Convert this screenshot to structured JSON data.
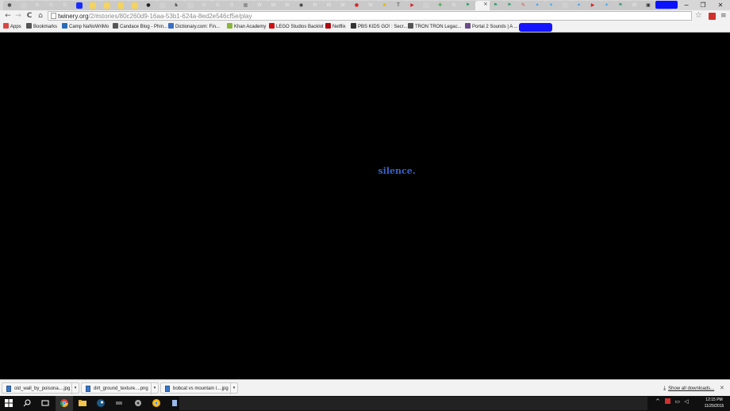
{
  "tabs": [
    {
      "icon": "globe-icon",
      "color": "#555555",
      "glyph": "●"
    },
    {
      "icon": "page-icon",
      "color": "#cfcfcf",
      "glyph": ""
    },
    {
      "icon": "google-icon",
      "color": "#e8e8e8",
      "glyph": "G"
    },
    {
      "icon": "google-icon",
      "color": "#e8e8e8",
      "glyph": "G"
    },
    {
      "icon": "google-icon",
      "color": "#e8e8e8",
      "glyph": "G"
    },
    {
      "icon": "blue-square-icon",
      "color": "#1a2bff",
      "glyph": ""
    },
    {
      "icon": "sticky-note-icon",
      "color": "#f4d35e",
      "glyph": ""
    },
    {
      "icon": "sticky-note-icon",
      "color": "#f4d35e",
      "glyph": ""
    },
    {
      "icon": "sticky-note-icon",
      "color": "#f4d35e",
      "glyph": ""
    },
    {
      "icon": "sticky-note-icon",
      "color": "#f4d35e",
      "glyph": ""
    },
    {
      "icon": "mickey-icon",
      "color": "#222222",
      "glyph": "●"
    },
    {
      "icon": "page-icon",
      "color": "#cfcfcf",
      "glyph": ""
    },
    {
      "icon": "horse-icon",
      "color": "#555555",
      "glyph": "♞"
    },
    {
      "icon": "page-icon",
      "color": "#cfcfcf",
      "glyph": ""
    },
    {
      "icon": "google-icon",
      "color": "#e8e8e8",
      "glyph": "G"
    },
    {
      "icon": "google-icon",
      "color": "#e8e8e8",
      "glyph": "G"
    },
    {
      "icon": "google-icon",
      "color": "#e8e8e8",
      "glyph": "G"
    },
    {
      "icon": "calculator-icon",
      "color": "#777777",
      "glyph": "▦"
    },
    {
      "icon": "wikipedia-icon",
      "color": "#e8e8e8",
      "glyph": "W"
    },
    {
      "icon": "wikipedia-icon",
      "color": "#e8e8e8",
      "glyph": "W"
    },
    {
      "icon": "wikipedia-icon",
      "color": "#e8e8e8",
      "glyph": "W"
    },
    {
      "icon": "camera-icon",
      "color": "#333333",
      "glyph": "◉"
    },
    {
      "icon": "gmail-icon",
      "color": "#e8e8e8",
      "glyph": "M"
    },
    {
      "icon": "wikipedia-icon",
      "color": "#e8e8e8",
      "glyph": "W"
    },
    {
      "icon": "wikipedia-icon",
      "color": "#e8e8e8",
      "glyph": "W"
    },
    {
      "icon": "red-circle-icon",
      "color": "#d22b2b",
      "glyph": "●"
    },
    {
      "icon": "wikipedia-icon",
      "color": "#e8e8e8",
      "glyph": "W"
    },
    {
      "icon": "star-badge-icon",
      "color": "#e0b000",
      "glyph": "★"
    },
    {
      "icon": "nyt-icon",
      "color": "#333333",
      "glyph": "T"
    },
    {
      "icon": "youtube-icon",
      "color": "#e02020",
      "glyph": "▶"
    },
    {
      "icon": "page-icon",
      "color": "#cfcfcf",
      "glyph": ""
    },
    {
      "icon": "puzzle-icon",
      "color": "#46a848",
      "glyph": "✚"
    },
    {
      "icon": "google-icon",
      "color": "#e8e8e8",
      "glyph": "G"
    },
    {
      "icon": "flag-icon",
      "color": "#2e9e6b",
      "glyph": "⚑"
    },
    {
      "icon": "page-icon",
      "color": "#f2f2f2",
      "glyph": "",
      "active": true
    },
    {
      "icon": "flag-icon",
      "color": "#2e9e6b",
      "glyph": "⚑"
    },
    {
      "icon": "flag-icon",
      "color": "#2e9e6b",
      "glyph": "⚑"
    },
    {
      "icon": "pencil-icon",
      "color": "#d04040",
      "glyph": "✎"
    },
    {
      "icon": "twitter-icon",
      "color": "#3aa0e8",
      "glyph": "✦"
    },
    {
      "icon": "twitter-icon",
      "color": "#3aa0e8",
      "glyph": "✦"
    },
    {
      "icon": "page-icon",
      "color": "#cfcfcf",
      "glyph": ""
    },
    {
      "icon": "twitter-icon",
      "color": "#3aa0e8",
      "glyph": "✦"
    },
    {
      "icon": "youtube-icon",
      "color": "#e02020",
      "glyph": "▶"
    },
    {
      "icon": "twitter-icon",
      "color": "#3aa0e8",
      "glyph": "✦"
    },
    {
      "icon": "flag-icon",
      "color": "#2e9e6b",
      "glyph": "⚑"
    },
    {
      "icon": "wikipedia-icon",
      "color": "#e8e8e8",
      "glyph": "W"
    },
    {
      "icon": "square-outline-icon",
      "color": "#333333",
      "glyph": "▣"
    },
    {
      "icon": "page-icon",
      "color": "#cfcfcf",
      "glyph": ""
    }
  ],
  "window_controls": {
    "minimize": "−",
    "restore": "❐",
    "close": "✕"
  },
  "toolbar": {
    "back": "←",
    "forward": "→",
    "reload": "C",
    "home": "⌂",
    "url_host": "twinery.org",
    "url_path": "/2/#stories/80c260d9-16aa-53b1-624a-8ed2e546cf5e/play",
    "star": "☆",
    "menu": "≡"
  },
  "bookmarks": [
    {
      "label": "Apps",
      "icon": "apps-grid-icon",
      "color": "#d44"
    },
    {
      "label": "Bookmarks",
      "icon": "star-icon",
      "color": "#555"
    },
    {
      "label": "Camp NaNoWriMo",
      "icon": "tent-icon",
      "color": "#2a6ab8"
    },
    {
      "label": "Candace Blog - Phin...",
      "icon": "link-icon",
      "color": "#555"
    },
    {
      "label": "Dictionary.com: Fin...",
      "icon": "dictionary-icon",
      "color": "#3b6fc4"
    },
    {
      "label": "Khan Academy",
      "icon": "leaf-icon",
      "color": "#8ab63c"
    },
    {
      "label": "LEGO Studios Backlot",
      "icon": "lego-icon",
      "color": "#d01012"
    },
    {
      "label": "Netflix",
      "icon": "netflix-icon",
      "color": "#b00710"
    },
    {
      "label": "PBS KIDS GO! : Secr...",
      "icon": "pbs-icon",
      "color": "#333"
    },
    {
      "label": "TRON  TRON Legac...",
      "icon": "link-icon",
      "color": "#555"
    },
    {
      "label": "Portal 2 Sounds | A ...",
      "icon": "portal-icon",
      "color": "#6a4a8a"
    }
  ],
  "page": {
    "text": "silence."
  },
  "downloads": {
    "items": [
      {
        "name": "old_wall_by_poisona....jpg"
      },
      {
        "name": "dirt_ground_texture....png"
      },
      {
        "name": "bobcat vs mountain l....jpg"
      }
    ],
    "show_all": "Show all downloads...",
    "close": "✕"
  },
  "taskbar": {
    "tray": "^",
    "time": "12:15 PM",
    "date": "11/29/2015"
  }
}
